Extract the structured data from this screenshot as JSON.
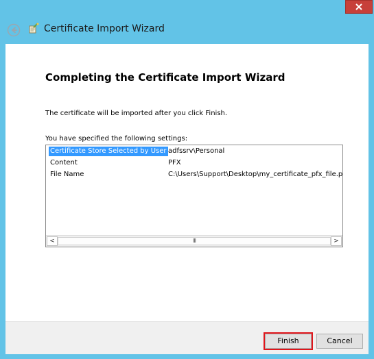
{
  "window": {
    "title": "Certificate Import Wizard",
    "close_label": "✕"
  },
  "page": {
    "heading": "Completing the Certificate Import Wizard",
    "info": "The certificate will be imported after you click Finish.",
    "settings_label": "You have specified the following settings:"
  },
  "settings": [
    {
      "name": "Certificate Store Selected by User",
      "value": "adfssrv\\Personal"
    },
    {
      "name": "Content",
      "value": "PFX"
    },
    {
      "name": "File Name",
      "value": "C:\\Users\\Support\\Desktop\\my_certificate_pfx_file.pf"
    }
  ],
  "scrollbar": {
    "left_arrow": "<",
    "right_arrow": ">",
    "thumb_grip": "III"
  },
  "buttons": {
    "finish": "Finish",
    "cancel": "Cancel"
  },
  "colors": {
    "window_frame": "#62c3e7",
    "close_button": "#c7403a",
    "selection": "#3399ff",
    "highlight_outline": "#e0151b"
  },
  "icons": {
    "back": "back-arrow-icon",
    "wizard": "certificate-wizard-icon",
    "close": "close-icon"
  }
}
